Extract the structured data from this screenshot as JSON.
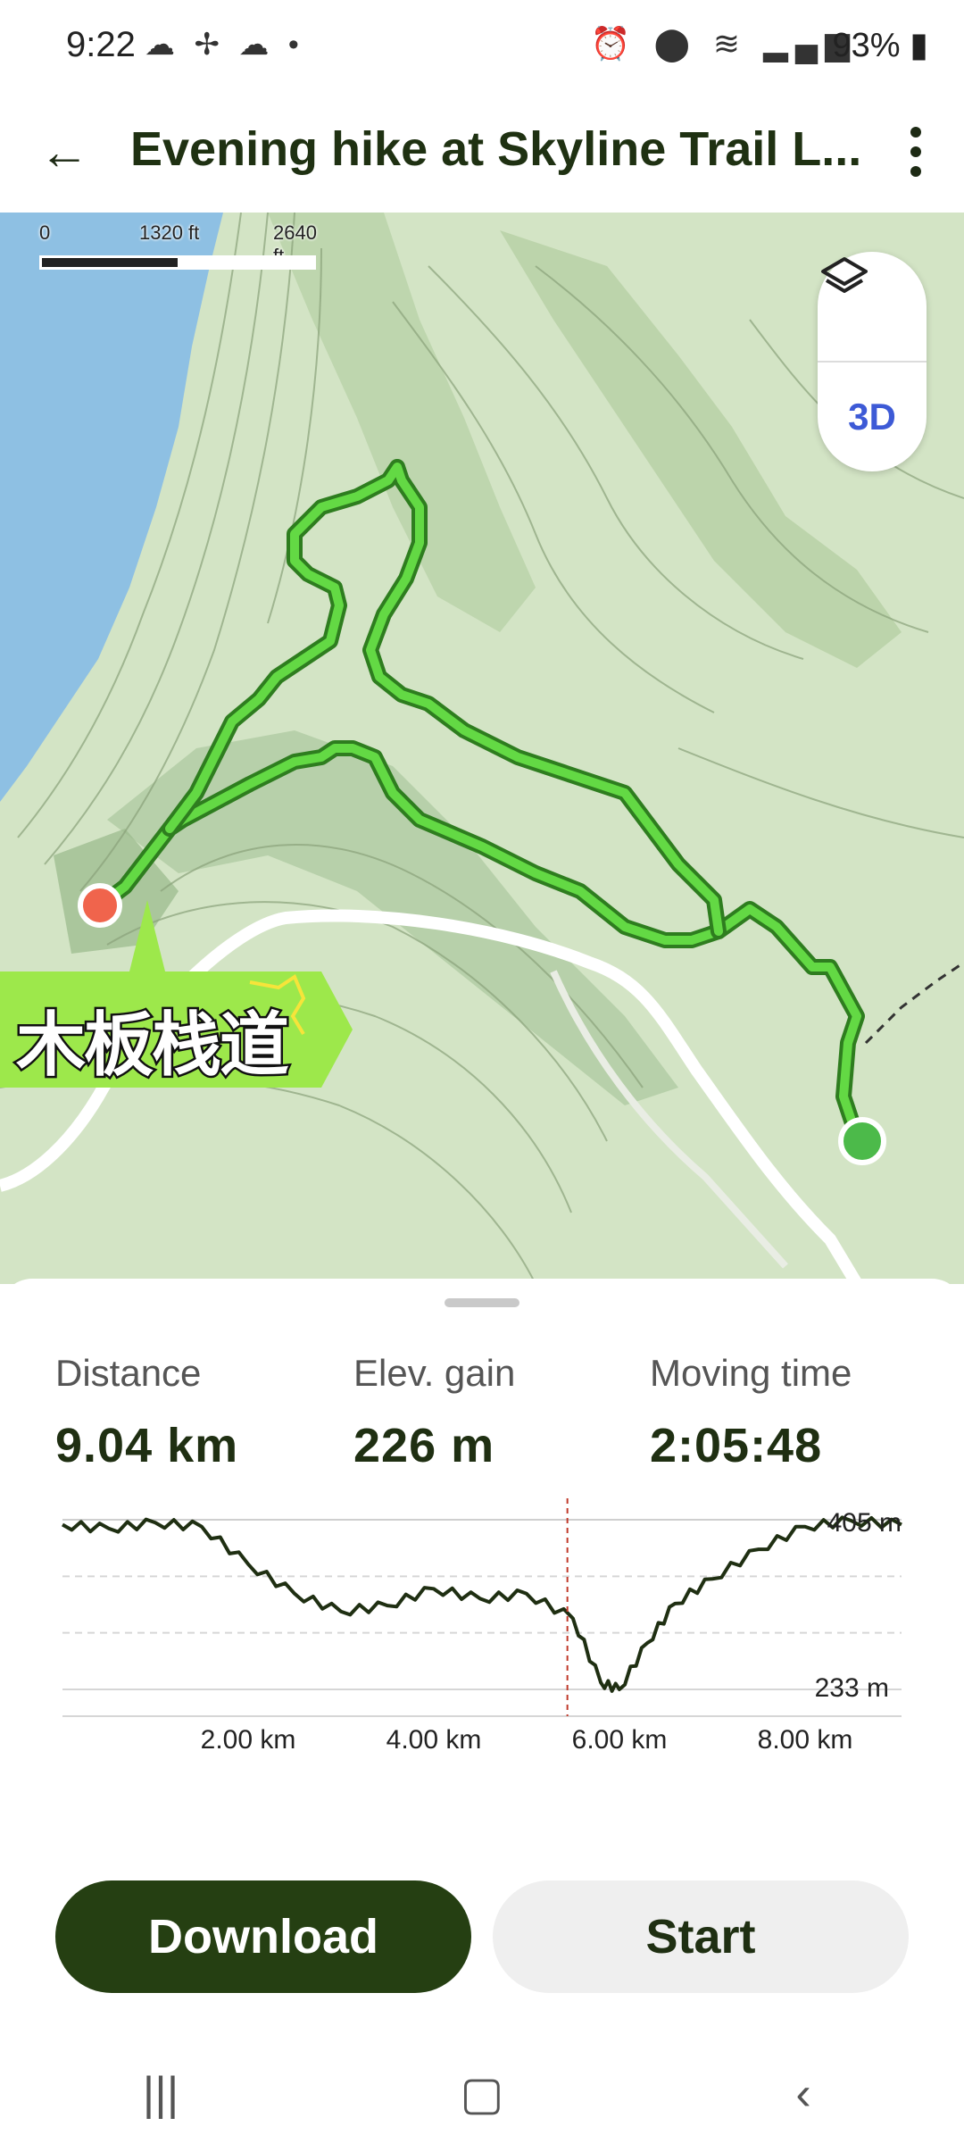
{
  "status_bar": {
    "time": "9:22",
    "left_icons": [
      "cloud-icon",
      "fan-icon",
      "cloud-icon",
      "dot-icon"
    ],
    "right_icons": [
      "alarm-icon",
      "location-icon",
      "wifi-icon",
      "signal-icon"
    ],
    "battery": "93%"
  },
  "header": {
    "title": "Evening hike at Skyline Trail L...",
    "back_icon": "arrow-left-icon",
    "menu_icon": "more-vertical-icon"
  },
  "map": {
    "scale_labels": [
      "0",
      "1320 ft",
      "2640 ft"
    ],
    "layers_icon": "layers-icon",
    "view_3d_label": "3D",
    "sticker_text": "木板栈道",
    "colors": {
      "route": "#5fd33f",
      "route_outline": "#2e7d1f",
      "water": "#8ec0e3",
      "land": "#d3e4c5",
      "start_marker": "#f0644c",
      "end_marker": "#4caf50"
    }
  },
  "stats": {
    "distance": {
      "label": "Distance",
      "value": "9.04 km"
    },
    "elevation_gain": {
      "label": "Elev. gain",
      "value": "226 m"
    },
    "moving_time": {
      "label": "Moving time",
      "value": "2:05:48"
    }
  },
  "elevation_chart": {
    "max_label": "405 m",
    "min_label": "233 m",
    "x_ticks": [
      "2.00 km",
      "4.00 km",
      "6.00 km",
      "8.00 km"
    ]
  },
  "chart_data": {
    "type": "line",
    "xlabel": "",
    "ylabel": "",
    "x": [
      0,
      0.5,
      1.0,
      1.5,
      2.0,
      2.5,
      3.0,
      3.5,
      4.0,
      4.5,
      5.0,
      5.5,
      5.8,
      6.0,
      6.3,
      6.6,
      7.0,
      7.5,
      8.0,
      8.5,
      9.04
    ],
    "series": [
      {
        "values": [
          400,
          396,
          402,
          398,
          360,
          330,
          312,
          318,
          335,
          325,
          330,
          305,
          240,
          233,
          280,
          320,
          345,
          375,
          398,
          404,
          400
        ]
      }
    ],
    "xlim": [
      0,
      9.04
    ],
    "ylim": [
      233,
      405
    ],
    "cursor_x": 5.44,
    "grid": true
  },
  "buttons": {
    "download": "Download",
    "start": "Start"
  },
  "nav_bar": {
    "recents_icon": "recents-icon",
    "home_icon": "home-icon",
    "back_icon": "nav-back-icon"
  }
}
